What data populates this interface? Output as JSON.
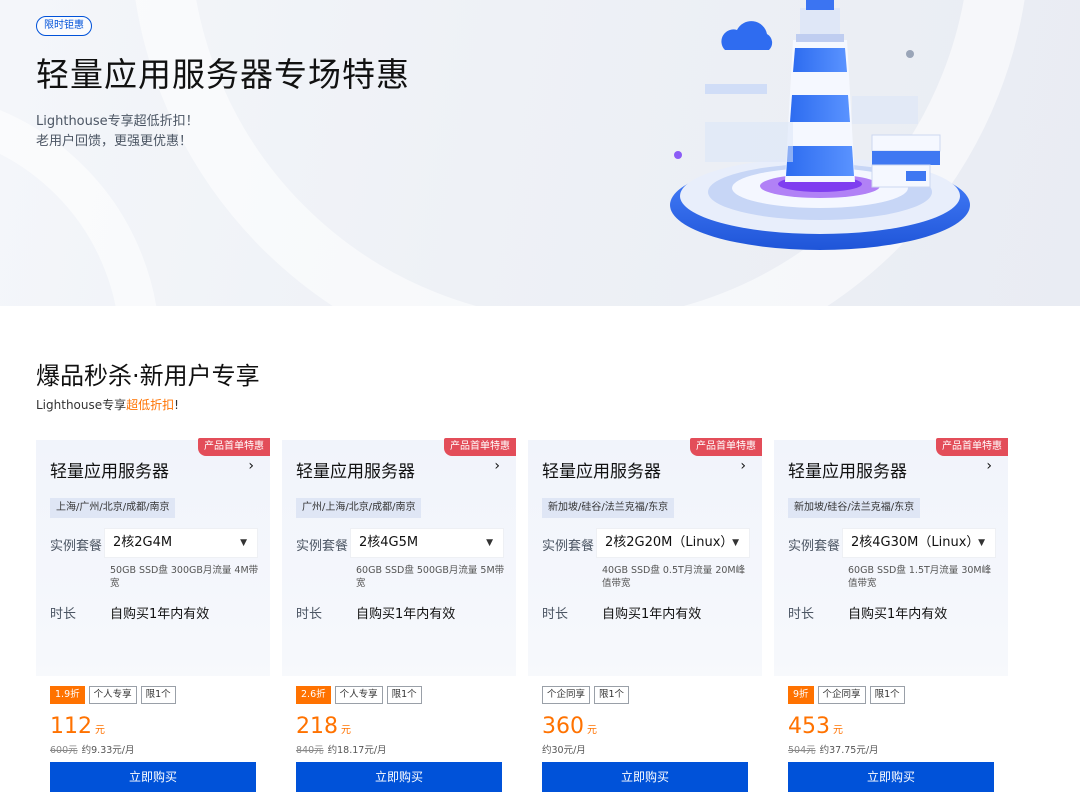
{
  "hero": {
    "badge": "限时钜惠",
    "title": "轻量应用服务器专场特惠",
    "sub1": "Lighthouse专享超低折扣！",
    "sub2": "老用户回馈，更强更优惠！"
  },
  "section": {
    "title": "爆品秒杀·新用户专享",
    "sub_prefix": "Lighthouse专享",
    "sub_highlight": "超低折扣",
    "sub_suffix": "!"
  },
  "labels": {
    "plan": "实例套餐",
    "duration": "时长",
    "buy": "立即购买"
  },
  "colors": {
    "accent": "#0052d9",
    "price": "#ff7200",
    "badge": "#e34d59"
  },
  "cards": [
    {
      "badge": "产品首单特惠",
      "title": "轻量应用服务器",
      "region": "上海/广州/北京/成都/南京",
      "plan": "2核2G4M",
      "desc": "50GB SSD盘 300GB月流量 4M带宽",
      "duration": "自购买1年内有效",
      "tags": [
        "1.9折",
        "个人专享",
        "限1个"
      ],
      "price": "112",
      "unit": "元",
      "old_price": "600元",
      "monthly": "约9.33元/月"
    },
    {
      "badge": "产品首单特惠",
      "title": "轻量应用服务器",
      "region": "广州/上海/北京/成都/南京",
      "plan": "2核4G5M",
      "desc": "60GB SSD盘 500GB月流量 5M带宽",
      "duration": "自购买1年内有效",
      "tags": [
        "2.6折",
        "个人专享",
        "限1个"
      ],
      "price": "218",
      "unit": "元",
      "old_price": "840元",
      "monthly": "约18.17元/月"
    },
    {
      "badge": "产品首单特惠",
      "title": "轻量应用服务器",
      "region": "新加坡/硅谷/法兰克福/东京",
      "plan": "2核2G20M（Linux）",
      "desc": "40GB SSD盘 0.5T月流量 20M峰值带宽",
      "duration": "自购买1年内有效",
      "tags": [
        "个企同享",
        "限1个"
      ],
      "price": "360",
      "unit": "元",
      "old_price": "",
      "monthly": "约30元/月"
    },
    {
      "badge": "产品首单特惠",
      "title": "轻量应用服务器",
      "region": "新加坡/硅谷/法兰克福/东京",
      "plan": "2核4G30M（Linux）",
      "desc": "60GB SSD盘 1.5T月流量 30M峰值带宽",
      "duration": "自购买1年内有效",
      "tags": [
        "9折",
        "个企同享",
        "限1个"
      ],
      "price": "453",
      "unit": "元",
      "old_price": "504元",
      "monthly": "约37.75元/月"
    }
  ]
}
